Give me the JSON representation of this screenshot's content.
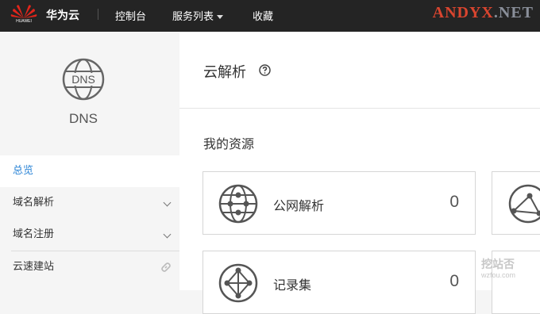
{
  "topbar": {
    "logo_text": "HUAWEI",
    "brand": "华为云",
    "nav": [
      {
        "label": "控制台"
      },
      {
        "label": "服务列表"
      },
      {
        "label": "收藏"
      }
    ],
    "watermark_a": "ANDYX",
    "watermark_b": ".NET"
  },
  "sidebar": {
    "service_name": "DNS",
    "items": [
      {
        "label": "总览"
      },
      {
        "label": "域名解析"
      },
      {
        "label": "域名注册"
      },
      {
        "label": "云速建站"
      }
    ]
  },
  "main": {
    "title": "云解析",
    "section": "我的资源",
    "cards": [
      {
        "label": "公网解析",
        "count": "0",
        "icon": "globe-network-icon"
      },
      {
        "label": "记录集",
        "count": "0",
        "icon": "globe-network-icon"
      }
    ],
    "overlay_stamp": "挖站否",
    "overlay_url": "wzfou.com"
  },
  "colors": {
    "topbar_bg": "#242424",
    "accent": "#2b84d6",
    "watermark_red": "#d9452f",
    "watermark_gray": "#8a8f9a"
  }
}
